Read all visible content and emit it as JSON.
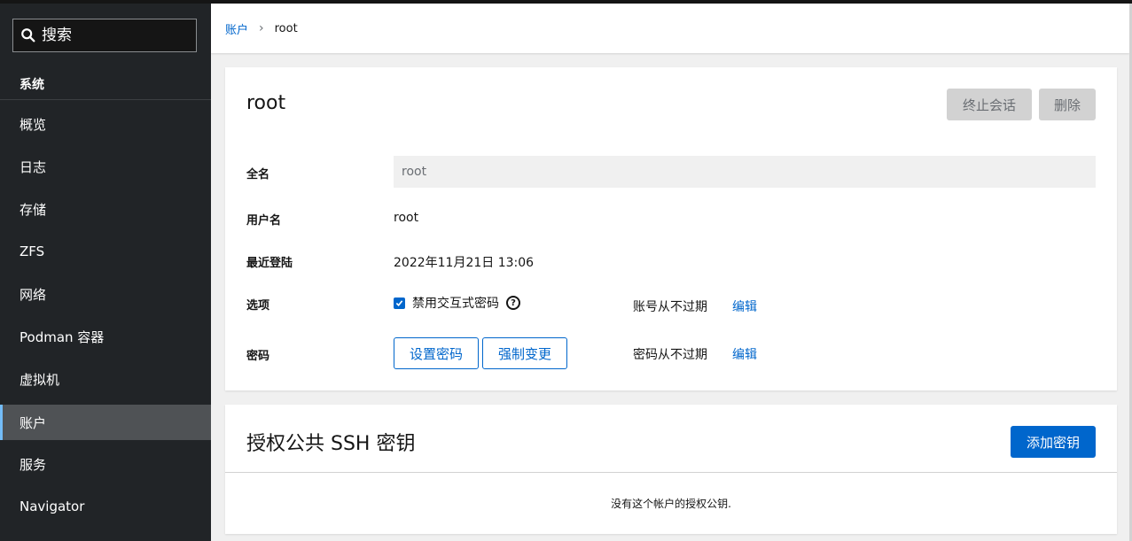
{
  "search": {
    "placeholder": "搜索"
  },
  "sidebar": {
    "section_title": "系统",
    "items": [
      {
        "label": "概览"
      },
      {
        "label": "日志"
      },
      {
        "label": "存储"
      },
      {
        "label": "ZFS"
      },
      {
        "label": "网络"
      },
      {
        "label": "Podman 容器"
      },
      {
        "label": "虚拟机"
      },
      {
        "label": "账户",
        "active": true
      },
      {
        "label": "服务"
      },
      {
        "label": "Navigator"
      }
    ]
  },
  "breadcrumb": {
    "parent": "账户",
    "current": "root"
  },
  "account": {
    "title": "root",
    "terminate_label": "终止会话",
    "delete_label": "删除",
    "fullname_label": "全名",
    "fullname_value": "root",
    "username_label": "用户名",
    "username_value": "root",
    "last_login_label": "最近登陆",
    "last_login_value": "2022年11月21日 13:06",
    "options_label": "选项",
    "disable_interactive_label": "禁用交互式密码",
    "account_expiry_text": "账号从不过期",
    "account_expiry_edit": "编辑",
    "password_label": "密码",
    "set_password_label": "设置密码",
    "force_change_label": "强制变更",
    "password_expiry_text": "密码从不过期",
    "password_expiry_edit": "编辑"
  },
  "ssh": {
    "title": "授权公共 SSH 密钥",
    "add_key_label": "添加密钥",
    "empty_message": "没有这个帐户的授权公钥."
  },
  "colors": {
    "accent": "#0066cc",
    "sidebar_bg": "#212427",
    "active_bar": "#73bcf7"
  }
}
